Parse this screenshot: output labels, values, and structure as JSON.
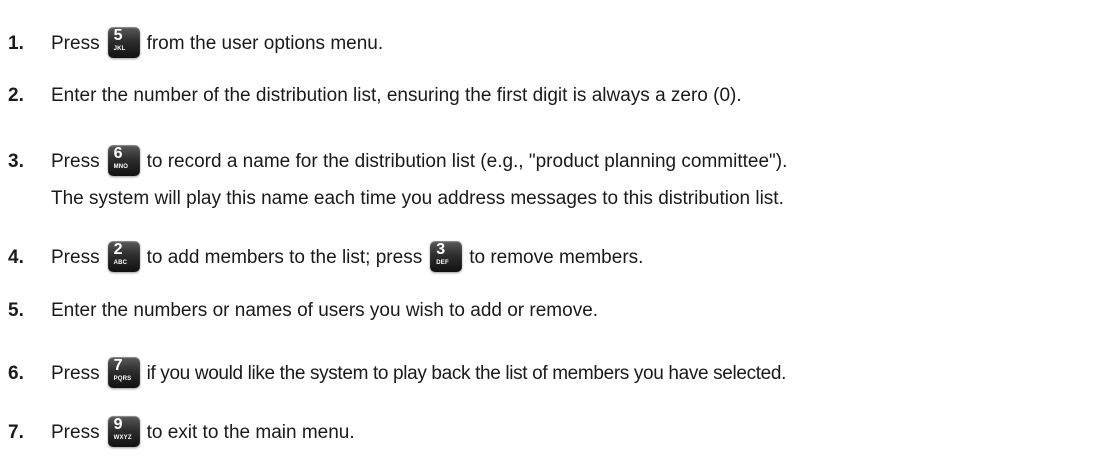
{
  "steps": [
    {
      "number": "1.",
      "before": "Press",
      "key": {
        "digit": "5",
        "letters": "JKL"
      },
      "after": "from the user options menu."
    },
    {
      "number": "2.",
      "text": "Enter the number of the distribution list, ensuring the first digit is always a zero (0)."
    },
    {
      "number": "3.",
      "before": "Press",
      "key": {
        "digit": "6",
        "letters": "MNO"
      },
      "after": "to record a name for the distribution list (e.g., \"product planning committee\").",
      "continuation": "The system will play this name each time you address messages to this distribution list."
    },
    {
      "number": "4.",
      "before": "Press",
      "key": {
        "digit": "2",
        "letters": "ABC"
      },
      "middle": "to add members to the list; press",
      "key2": {
        "digit": "3",
        "letters": "DEF"
      },
      "after": "to remove members."
    },
    {
      "number": "5.",
      "text": "Enter the numbers or names of users you wish to add or remove."
    },
    {
      "number": "6.",
      "before": "Press",
      "key": {
        "digit": "7",
        "letters": "PQRS"
      },
      "after": "if you would like the system to play back the list of members you have selected."
    },
    {
      "number": "7.",
      "before": "Press",
      "key": {
        "digit": "9",
        "letters": "WXYZ"
      },
      "after": "to exit to the main menu."
    }
  ]
}
